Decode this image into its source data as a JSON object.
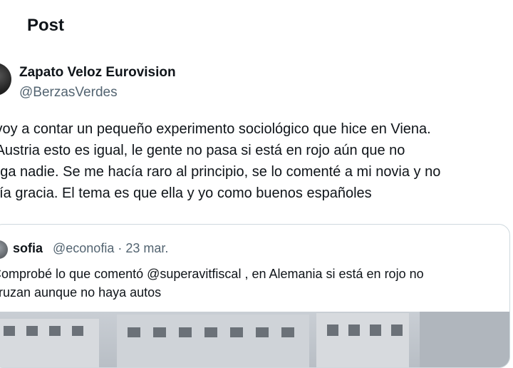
{
  "header": {
    "title": "Post"
  },
  "author": {
    "display_name": "Zapato Veloz Eurovision",
    "handle": "@BerzasVerdes"
  },
  "post": {
    "lines": [
      "s voy a contar un pequeño experimento sociológico que hice en Viena.",
      "n Austria esto es igual, le gente no pasa si está en rojo aún que no",
      "enga nadie. Se me hacía raro al principio, se lo comenté a mi novia y no",
      "acía gracia. El tema es que ella y yo como buenos españoles"
    ]
  },
  "quote": {
    "name": "sofia",
    "meta": "@econofia · 23 mar.",
    "lines": [
      "Comprobé lo que comentó @superavitfiscal , en Alemania si está en rojo no",
      "cruzan aunque no haya autos"
    ]
  },
  "colors": {
    "text": "#0f1419",
    "secondary": "#536471",
    "border": "#cfd9de"
  }
}
